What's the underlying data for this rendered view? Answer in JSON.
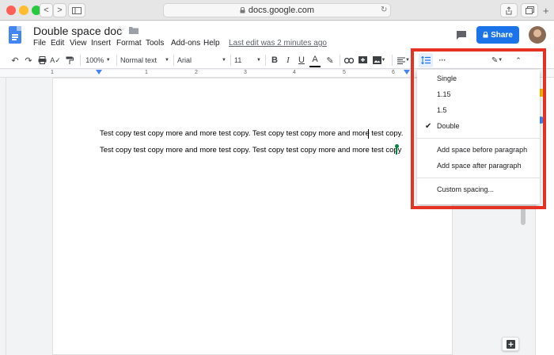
{
  "browser": {
    "url": "docs.google.com",
    "back": "<",
    "forward": ">"
  },
  "doc": {
    "title": "Double space doc",
    "last_edit": "Last edit was 2 minutes ago",
    "share_label": "Share"
  },
  "menu": [
    "File",
    "Edit",
    "View",
    "Insert",
    "Format",
    "Tools",
    "Add-ons",
    "Help"
  ],
  "toolbar": {
    "zoom": "100%",
    "style": "Normal text",
    "font": "Arial",
    "size": "11",
    "bold": "B",
    "italic": "I",
    "underline": "U",
    "text_color": "A",
    "more": "···"
  },
  "ruler": {
    "n1": "1",
    "n2": "1",
    "n3": "2",
    "n4": "3",
    "n5": "4",
    "n6": "5",
    "n7": "6"
  },
  "content": {
    "line1": "Test copy test copy more and more test copy. Test copy test copy more and more test copy.",
    "line2": "Test copy test copy more and more test copy. Test copy test copy more and more test copy"
  },
  "line_spacing_menu": {
    "options": [
      "Single",
      "1.15",
      "1.5",
      "Double"
    ],
    "selected": "Double",
    "add_before": "Add space before paragraph",
    "add_after": "Add space after paragraph",
    "custom": "Custom spacing..."
  },
  "colors": {
    "accent": "#1a73e8",
    "highlight_border": "#e53223",
    "collab_cursor": "#0b8043"
  }
}
